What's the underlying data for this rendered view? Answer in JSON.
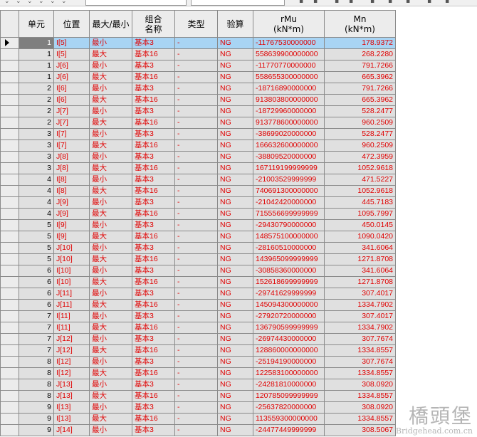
{
  "headers": {
    "unit": "单元",
    "position": "位置",
    "maxmin": "最大/最小",
    "combo_line1": "组合",
    "combo_line2": "名称",
    "type": "类型",
    "check": "验算",
    "rmu_line1": "rMu",
    "rmu_line2": "(kN*m)",
    "mn_line1": "Mn",
    "mn_line2": "(kN*m)"
  },
  "rows": [
    [
      "1",
      "I[5]",
      "最小",
      "基本3",
      "-",
      "NG",
      "-11767530000000",
      "178.9372"
    ],
    [
      "1",
      "I[5]",
      "最大",
      "基本16",
      "-",
      "NG",
      "558639900000000",
      "268.2280"
    ],
    [
      "1",
      "J[6]",
      "最小",
      "基本3",
      "-",
      "NG",
      "-11770770000000",
      "791.7266"
    ],
    [
      "1",
      "J[6]",
      "最大",
      "基本16",
      "-",
      "NG",
      "558655300000000",
      "665.3962"
    ],
    [
      "2",
      "I[6]",
      "最小",
      "基本3",
      "-",
      "NG",
      "-18716890000000",
      "791.7266"
    ],
    [
      "2",
      "I[6]",
      "最大",
      "基本16",
      "-",
      "NG",
      "913803800000000",
      "665.3962"
    ],
    [
      "2",
      "J[7]",
      "最小",
      "基本3",
      "-",
      "NG",
      "-18729960000000",
      "528.2477"
    ],
    [
      "2",
      "J[7]",
      "最大",
      "基本16",
      "-",
      "NG",
      "913778600000000",
      "960.2509"
    ],
    [
      "3",
      "I[7]",
      "最小",
      "基本3",
      "-",
      "NG",
      "-38699020000000",
      "528.2477"
    ],
    [
      "3",
      "I[7]",
      "最大",
      "基本16",
      "-",
      "NG",
      "166632600000000",
      "960.2509"
    ],
    [
      "3",
      "J[8]",
      "最小",
      "基本3",
      "-",
      "NG",
      "-38809520000000",
      "472.3959"
    ],
    [
      "3",
      "J[8]",
      "最大",
      "基本16",
      "-",
      "NG",
      "167119199999999",
      "1052.9618"
    ],
    [
      "4",
      "I[8]",
      "最小",
      "基本3",
      "-",
      "NG",
      "-21003529999999",
      "471.5227"
    ],
    [
      "4",
      "I[8]",
      "最大",
      "基本16",
      "-",
      "NG",
      "740691300000000",
      "1052.9618"
    ],
    [
      "4",
      "J[9]",
      "最小",
      "基本3",
      "-",
      "NG",
      "-21042420000000",
      "445.7183"
    ],
    [
      "4",
      "J[9]",
      "最大",
      "基本16",
      "-",
      "NG",
      "715556699999999",
      "1095.7997"
    ],
    [
      "5",
      "I[9]",
      "最小",
      "基本3",
      "-",
      "NG",
      "-29430790000000",
      "450.0145"
    ],
    [
      "5",
      "I[9]",
      "最大",
      "基本16",
      "-",
      "NG",
      "148575100000000",
      "1090.0420"
    ],
    [
      "5",
      "J[10]",
      "最小",
      "基本3",
      "-",
      "NG",
      "-28160510000000",
      "341.6064"
    ],
    [
      "5",
      "J[10]",
      "最大",
      "基本16",
      "-",
      "NG",
      "143965099999999",
      "1271.8708"
    ],
    [
      "6",
      "I[10]",
      "最小",
      "基本3",
      "-",
      "NG",
      "-30858360000000",
      "341.6064"
    ],
    [
      "6",
      "I[10]",
      "最大",
      "基本16",
      "-",
      "NG",
      "152618699999999",
      "1271.8708"
    ],
    [
      "6",
      "J[11]",
      "最小",
      "基本3",
      "-",
      "NG",
      "-29741629999999",
      "307.4017"
    ],
    [
      "6",
      "J[11]",
      "最大",
      "基本16",
      "-",
      "NG",
      "145094300000000",
      "1334.7902"
    ],
    [
      "7",
      "I[11]",
      "最小",
      "基本3",
      "-",
      "NG",
      "-27920720000000",
      "307.4017"
    ],
    [
      "7",
      "I[11]",
      "最大",
      "基本16",
      "-",
      "NG",
      "136790599999999",
      "1334.7902"
    ],
    [
      "7",
      "J[12]",
      "最小",
      "基本3",
      "-",
      "NG",
      "-26974430000000",
      "307.7674"
    ],
    [
      "7",
      "J[12]",
      "最大",
      "基本16",
      "-",
      "NG",
      "128860000000000",
      "1334.8557"
    ],
    [
      "8",
      "I[12]",
      "最小",
      "基本3",
      "-",
      "NG",
      "-25194190000000",
      "307.7674"
    ],
    [
      "8",
      "I[12]",
      "最大",
      "基本16",
      "-",
      "NG",
      "122583100000000",
      "1334.8557"
    ],
    [
      "8",
      "J[13]",
      "最小",
      "基本3",
      "-",
      "NG",
      "-24281810000000",
      "308.0920"
    ],
    [
      "8",
      "J[13]",
      "最大",
      "基本16",
      "-",
      "NG",
      "120785099999999",
      "1334.8557"
    ],
    [
      "9",
      "I[13]",
      "最小",
      "基本3",
      "-",
      "NG",
      "-25637820000000",
      "308.0920"
    ],
    [
      "9",
      "I[13]",
      "最大",
      "基本16",
      "-",
      "NG",
      "113559300000000",
      "1334.8557"
    ],
    [
      "9",
      "J[14]",
      "最小",
      "基本3",
      "-",
      "NG",
      "-24477449999999",
      "308.5067"
    ]
  ],
  "watermark": {
    "cn": "橋頭堡",
    "en": "Bridgehead.com.cn"
  },
  "colors": {
    "value_text": "#e00000",
    "row_bg": "#e0e0e0",
    "selected_row_bg": "#a8d4f4"
  }
}
